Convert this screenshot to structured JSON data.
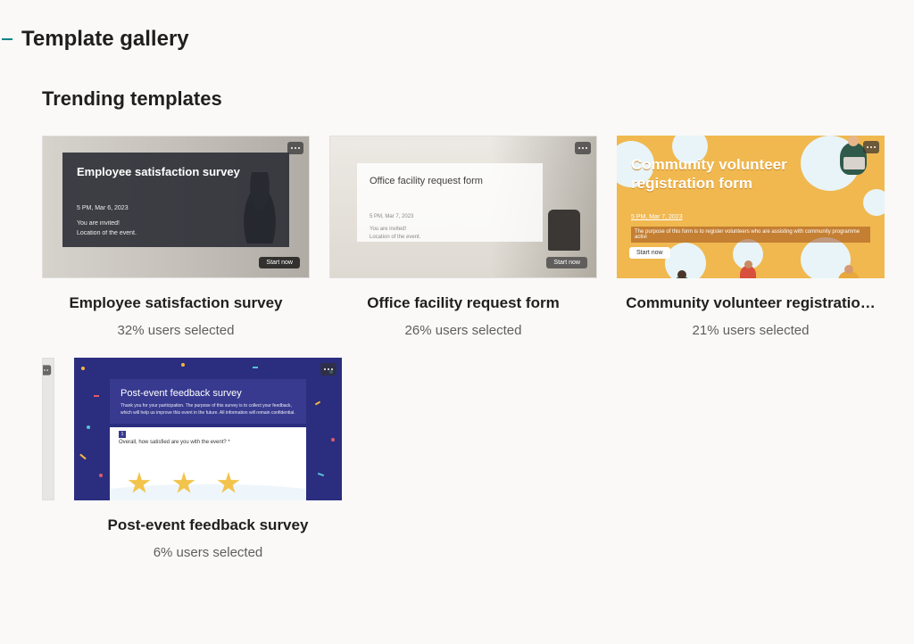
{
  "header": {
    "title": "Template gallery"
  },
  "section": {
    "title": "Trending templates"
  },
  "templates": [
    {
      "title": "Employee satisfaction survey",
      "subtitle": "32% users selected",
      "thumb": {
        "heading": "Employee satisfaction survey",
        "date": "5 PM, Mar 6, 2023",
        "line1": "You are invited!",
        "line2": "Location of the event.",
        "button": "Start now"
      }
    },
    {
      "title": "Office facility request form",
      "subtitle": "26% users selected",
      "thumb": {
        "heading": "Office facility request form",
        "date": "5 PM, Mar 7, 2023",
        "line1": "You are invited!",
        "line2": "Location of the event.",
        "button": "Start now"
      }
    },
    {
      "title": "Community volunteer registratio…",
      "subtitle": "21% users selected",
      "thumb": {
        "heading_line1": "Community volunteer",
        "heading_line2": "registration form",
        "date": "5 PM, Mar 7, 2023",
        "desc": "The purpose of this form is to register volunteers who are assisting with community programme activi",
        "button": "Start now"
      }
    },
    {
      "title": "Post-event feedback survey",
      "subtitle": "6% users selected",
      "thumb": {
        "heading": "Post-event feedback survey",
        "sub": "Thank you for your participation. The purpose of this survey is to collect your feedback, which will help us improve this event in the future. All information will remain confidential.",
        "qnum": "1",
        "question": "Overall, how satisfied are you with the event? *"
      }
    }
  ]
}
